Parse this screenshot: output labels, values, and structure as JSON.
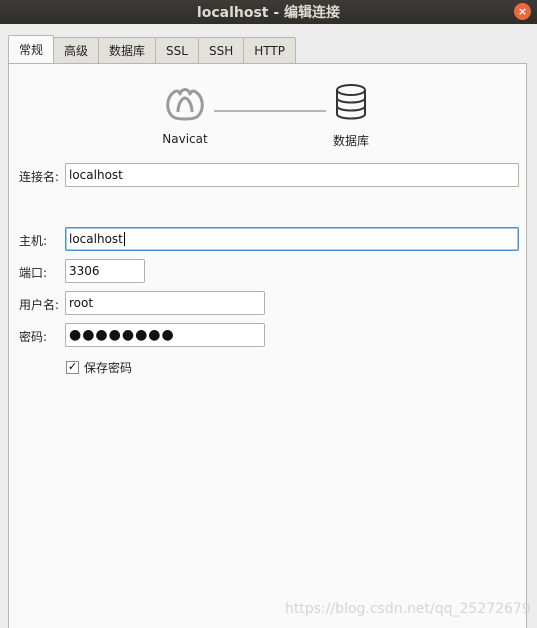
{
  "window": {
    "title": "localhost - 编辑连接",
    "close_glyph": "×"
  },
  "tabs": [
    {
      "label": "常规",
      "active": true
    },
    {
      "label": "高级"
    },
    {
      "label": "数据库"
    },
    {
      "label": "SSL"
    },
    {
      "label": "SSH"
    },
    {
      "label": "HTTP"
    }
  ],
  "diagram": {
    "left_label": "Navicat",
    "right_label": "数据库",
    "left_icon": "navicat-icon",
    "right_icon": "database-icon"
  },
  "form": {
    "connection_name_label": "连接名:",
    "connection_name_value": "localhost",
    "host_label": "主机:",
    "host_value": "localhost",
    "port_label": "端口:",
    "port_value": "3306",
    "username_label": "用户名:",
    "username_value": "root",
    "password_label": "密码:",
    "password_mask": "●●●●●●●●",
    "save_password_label": "保存密码",
    "save_password_checked": true,
    "check_glyph": "✓"
  },
  "watermark": "https://blog.csdn.net/qq_25272679"
}
